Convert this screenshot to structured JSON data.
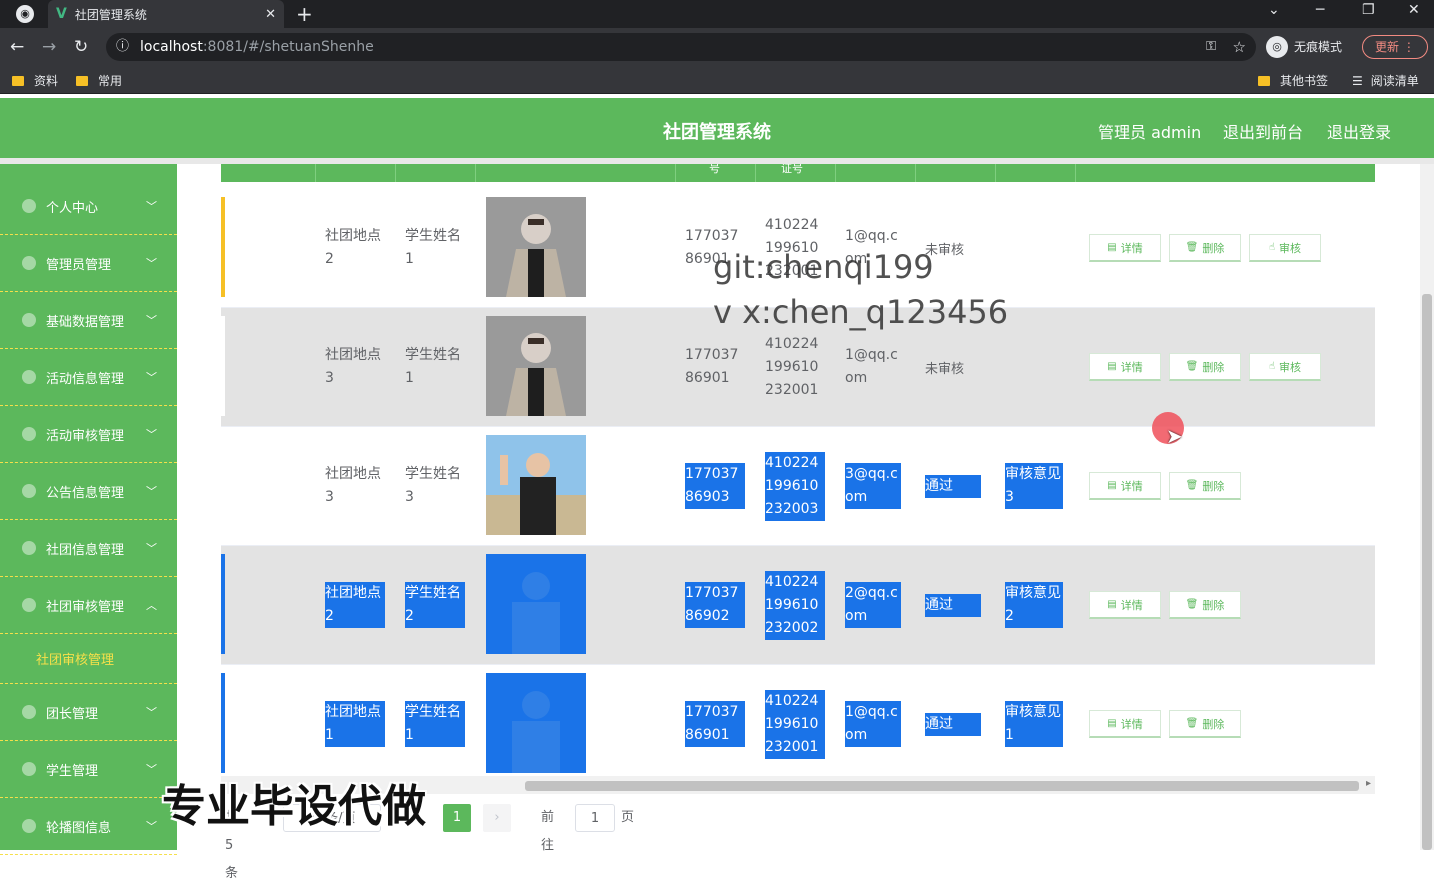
{
  "browser": {
    "tab_title": "社团管理系统",
    "tab_close": "✕",
    "new_tab": "+",
    "url_host": "localhost",
    "url_path": ":8081/#/shetuanShenhe",
    "incognito_label": "无痕模式",
    "update_label": "更新",
    "bookmarks": [
      "资料",
      "常用"
    ],
    "bookmarks_right": [
      "其他书签",
      "阅读清单"
    ]
  },
  "header": {
    "title": "社团管理系统",
    "admin_label": "管理员 admin",
    "back_label": "退出到前台",
    "logout_label": "退出登录"
  },
  "sidebar": {
    "items": [
      "个人中心",
      "管理员管理",
      "基础数据管理",
      "活动信息管理",
      "活动审核管理",
      "公告信息管理",
      "社团信息管理",
      "社团审核管理",
      "团长管理",
      "学生管理",
      "轮播图信息"
    ],
    "submenu": "社团审核管理"
  },
  "table": {
    "header_fragments": [
      "号",
      "证号"
    ],
    "rows": [
      {
        "location": "社团地点2",
        "student": "学生姓名1",
        "phone": "17703786901",
        "id_card": "410224199610232001",
        "email": "1@qq.com",
        "status": "未审核",
        "opinion": "",
        "actions": [
          "详情",
          "删除",
          "审核"
        ]
      },
      {
        "location": "社团地点3",
        "student": "学生姓名1",
        "phone": "17703786901",
        "id_card": "410224199610232001",
        "email": "1@qq.com",
        "status": "未审核",
        "opinion": "",
        "actions": [
          "详情",
          "删除",
          "审核"
        ]
      },
      {
        "location": "社团地点3",
        "student": "学生姓名3",
        "phone": "17703786903",
        "id_card": "410224199610232003",
        "email": "3@qq.com",
        "status": "通过",
        "opinion": "审核意见3",
        "actions": [
          "详情",
          "删除"
        ]
      },
      {
        "location": "社团地点2",
        "student": "学生姓名2",
        "phone": "17703786902",
        "id_card": "410224199610232002",
        "email": "2@qq.com",
        "status": "通过",
        "opinion": "审核意见2",
        "actions": [
          "详情",
          "删除"
        ]
      },
      {
        "location": "社团地点1",
        "student": "学生姓名1",
        "phone": "17703786901",
        "id_card": "410224199610232001",
        "email": "1@qq.com",
        "status": "通过",
        "opinion": "审核意见1",
        "actions": [
          "详情",
          "删除"
        ]
      }
    ]
  },
  "pager": {
    "total": "共 5 条",
    "page_size": "10条/页",
    "current": "1",
    "goto_label": "前往",
    "goto_value": "1",
    "page_unit": "页"
  },
  "overlay": {
    "watermark_git": "git:chenqi199",
    "watermark_vx": "v x:chen_q123456",
    "watermark_ad": "专业毕设代做"
  },
  "colors": {
    "accent": "#5cb85c",
    "selection": "#1a73e8",
    "menu_highlight": "#f6e04a"
  }
}
